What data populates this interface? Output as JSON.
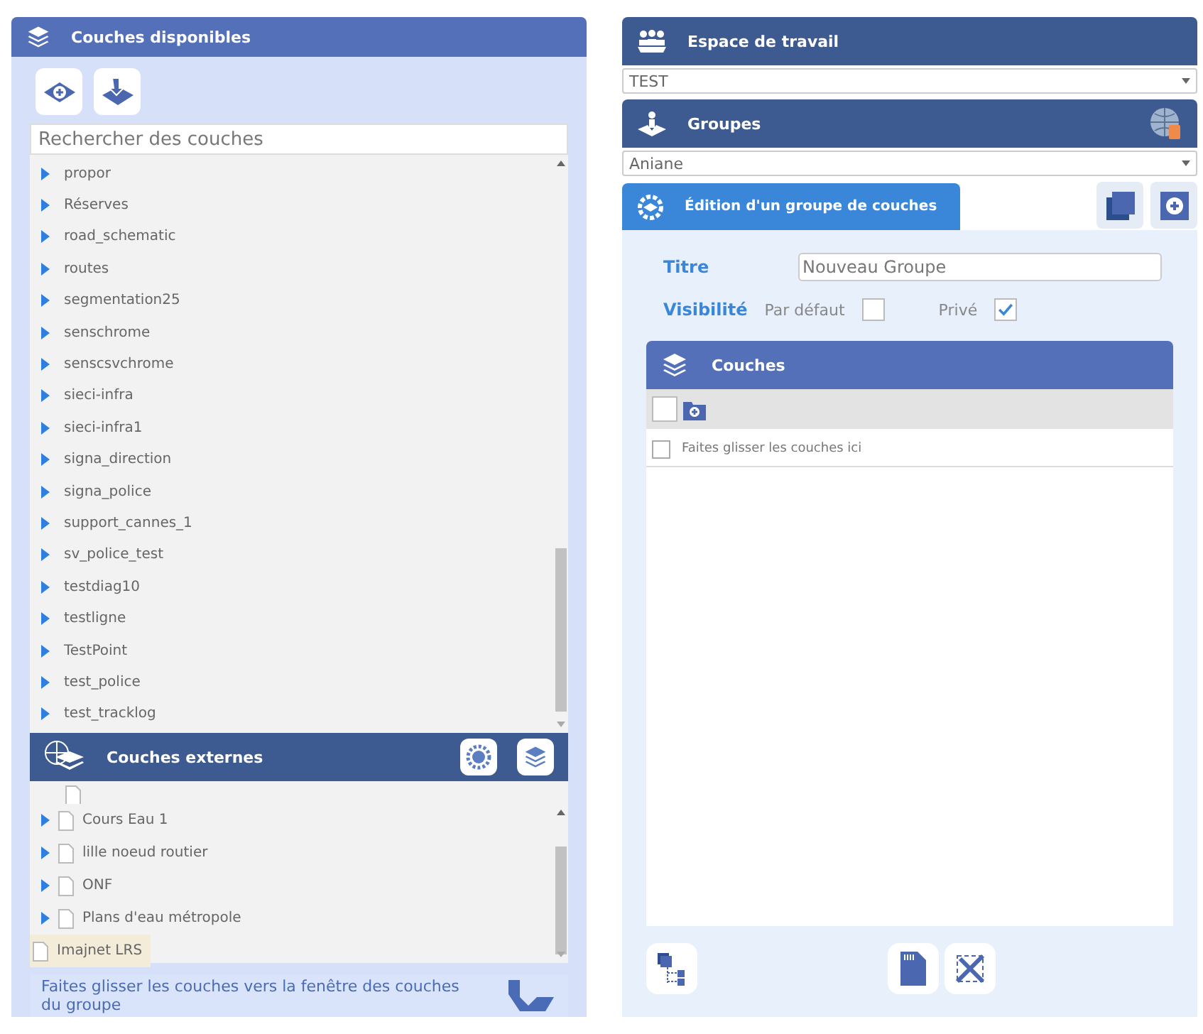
{
  "available_layers": {
    "title": "Couches disponibles",
    "search": {
      "placeholder": "Rechercher des couches"
    },
    "items": [
      {
        "label": "propor"
      },
      {
        "label": "Réserves"
      },
      {
        "label": "road_schematic"
      },
      {
        "label": "routes"
      },
      {
        "label": "segmentation25"
      },
      {
        "label": "senschrome"
      },
      {
        "label": "senscsvchrome"
      },
      {
        "label": "sieci-infra"
      },
      {
        "label": "sieci-infra1"
      },
      {
        "label": "signa_direction"
      },
      {
        "label": "signa_police"
      },
      {
        "label": "support_cannes_1"
      },
      {
        "label": "sv_police_test"
      },
      {
        "label": "testdiag10"
      },
      {
        "label": "testligne"
      },
      {
        "label": "TestPoint"
      },
      {
        "label": "test_police"
      },
      {
        "label": "test_tracklog"
      }
    ]
  },
  "external_layers": {
    "title": "Couches externes",
    "items": [
      {
        "label": "Cours Eau 1",
        "kind": "group",
        "selected": false
      },
      {
        "label": "lille noeud routier",
        "kind": "group",
        "selected": false
      },
      {
        "label": "ONF",
        "kind": "group",
        "selected": false
      },
      {
        "label": "Plans d'eau métropole",
        "kind": "group",
        "selected": false
      },
      {
        "label": "Imajnet LRS",
        "kind": "layer",
        "selected": true
      }
    ],
    "hint": "Faites glisser les couches vers la fenêtre des couches du groupe"
  },
  "workspace": {
    "title": "Espace de travail",
    "value": "TEST"
  },
  "groups": {
    "title": "Groupes",
    "value": "Aniane"
  },
  "edit": {
    "tab": "Édition d'un groupe de couches",
    "title_label": "Titre",
    "title_placeholder": "Nouveau Groupe",
    "visibility_label": "Visibilité",
    "options": [
      {
        "label": "Par défaut",
        "checked": false
      },
      {
        "label": "Privé",
        "checked": true
      }
    ],
    "layers": {
      "title": "Couches",
      "select_all_checked": false,
      "rows": [
        {
          "label": "Faites glisser les couches ici",
          "checked": false
        }
      ]
    }
  }
}
